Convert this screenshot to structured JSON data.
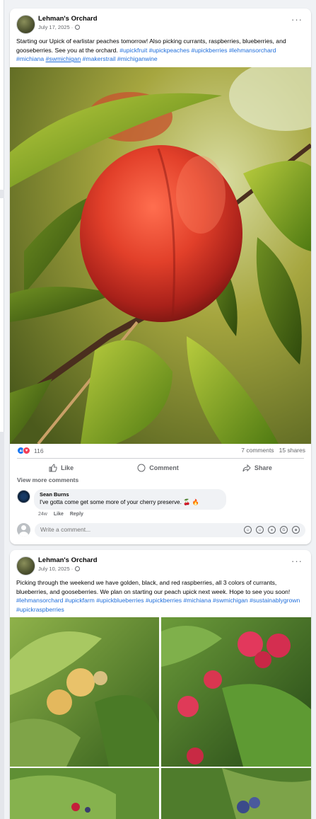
{
  "post1": {
    "page_name": "Lehman's Orchard",
    "date": "July 17, 2025 ·",
    "text": "Starting our Upick of earlistar peaches tomorrow!  Also picking currants, raspberries, blueberries, and gooseberries.  See you at the orchard.",
    "hashtags_a": "#upickfruit #upickpeaches #upickberries #lehmansorchard #michiana",
    "hashtag_underlined": "#swmichigan",
    "hashtags_b": "#makerstrail #michiganwine",
    "reaction_count": "116",
    "comments": "7 comments",
    "shares": "15 shares",
    "like_label": "Like",
    "comment_label": "Comment",
    "share_label": "Share",
    "view_more": "View more comments",
    "comment": {
      "author": "Sean Burns",
      "text": "I've gotta come get some more of your cherry preserve. 🍒 🔥",
      "age": "24w",
      "like": "Like",
      "reply": "Reply"
    },
    "write_placeholder": "Write a comment..."
  },
  "post2": {
    "page_name": "Lehman's Orchard",
    "date": "July 10, 2025 ·",
    "text": "Picking through the weekend we have golden, black, and red raspberries, all 3 colors of currants, blueberries, and gooseberries.  We plan on starting our peach upick next week.    Hope to see you soon!",
    "hashtags": "#lehmansorchard #upickfarm  #upickblueberries #upickberries #michiana #swmichigan #sustainablygrown  #upickraspberries"
  },
  "icons": {
    "menu": "more-options-icon",
    "privacy": "globe-icon",
    "like": "thumbs-up-icon",
    "comment": "speech-bubble-icon",
    "share": "share-arrow-icon"
  },
  "colors": {
    "link": "#216fdb",
    "like_blue": "#1877f2",
    "love_red": "#f33e58",
    "background": "#f0f2f5"
  }
}
